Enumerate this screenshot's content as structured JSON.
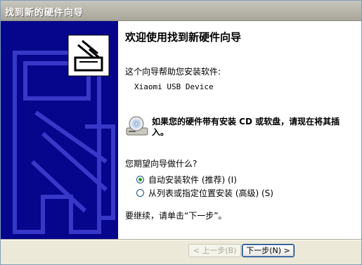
{
  "window": {
    "title": "找到新的硬件向导"
  },
  "wizard": {
    "heading": "欢迎使用找到新硬件向导",
    "intro": "这个向导帮助您安装软件:",
    "device_name": "Xiaomi USB Device",
    "cd_note": "如果您的硬件带有安装 CD 或软盘，请现在将其插入。",
    "question": "您期望向导做什么?",
    "options": [
      {
        "label": "自动安装软件 (推荐) (I)",
        "selected": true
      },
      {
        "label": "从列表或指定位置安装 (高级) (S)",
        "selected": false
      }
    ],
    "continue_text": "要继续，请单击“下一步”。"
  },
  "buttons": {
    "back": "< 上一步(B)",
    "next": "下一步(N) >"
  },
  "colors": {
    "side_panel": "#06068c",
    "title_bar": "#b6b3a8",
    "radio_dot": "#21a121"
  },
  "icons": {
    "hardware": "hardware-install-icon",
    "cd": "cd-drive-icon"
  }
}
